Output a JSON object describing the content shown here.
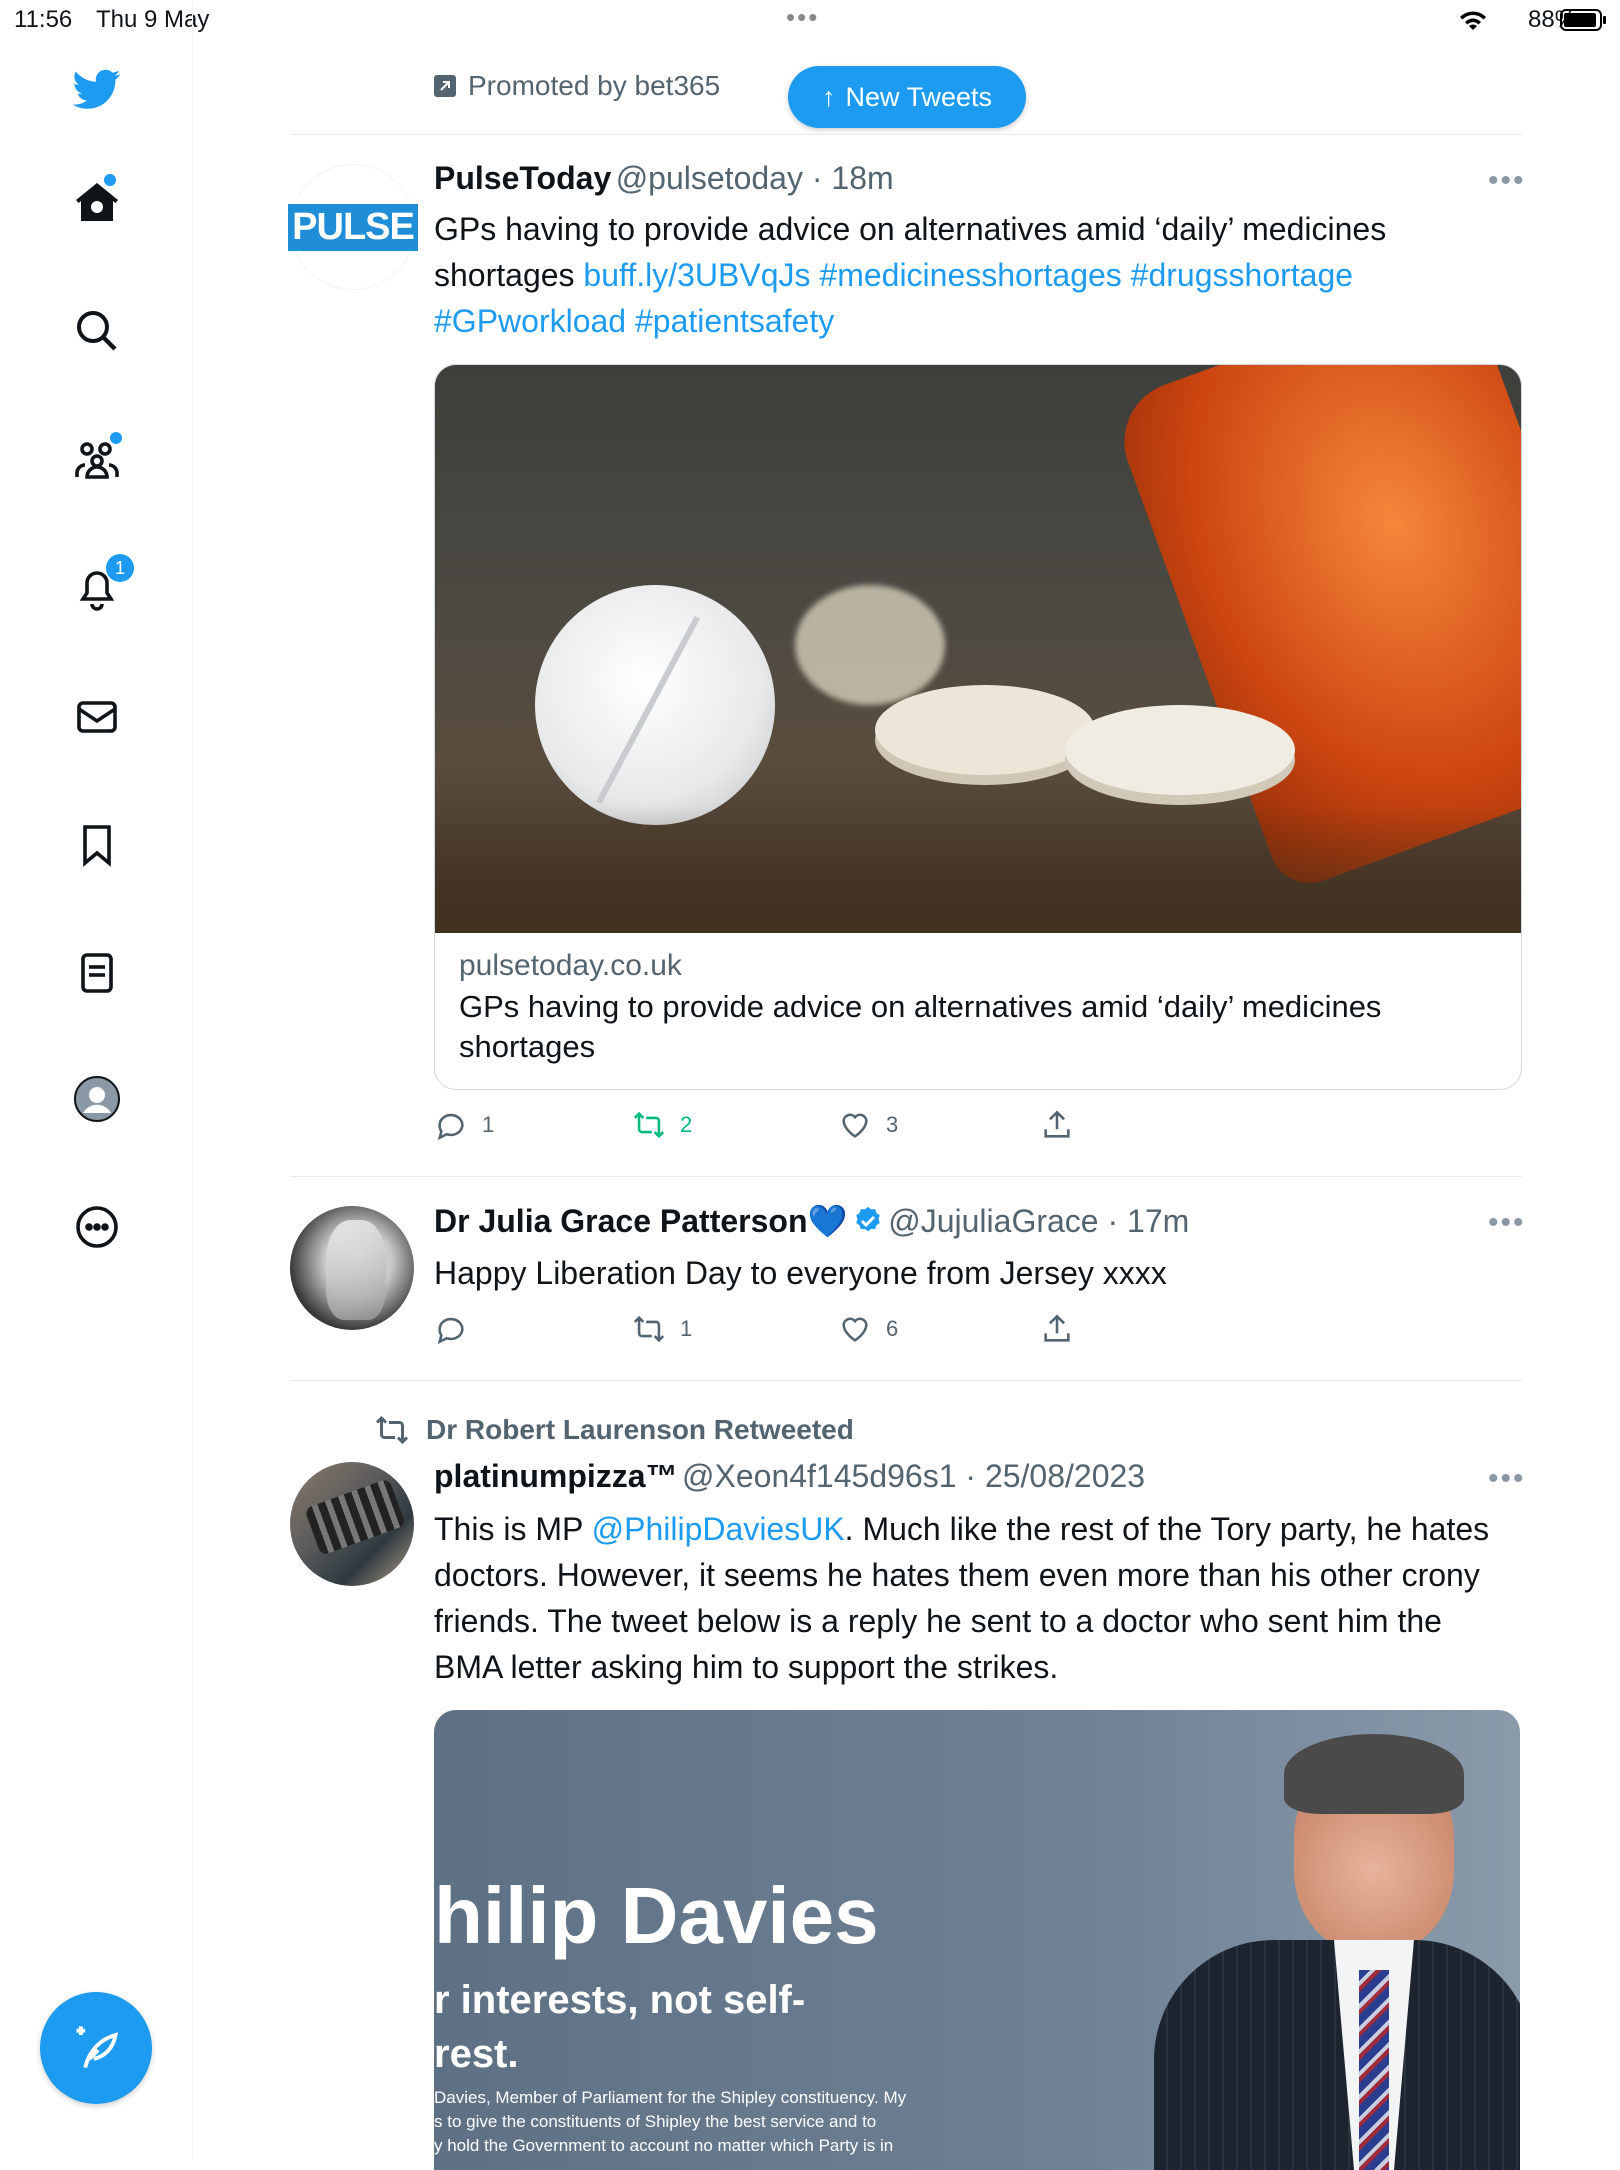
{
  "status_bar": {
    "time": "11:56",
    "date": "Thu 9 May",
    "battery": "88%"
  },
  "sidebar": {
    "items": [
      {
        "icon": "twitter-bird-icon"
      },
      {
        "icon": "home-icon"
      },
      {
        "icon": "search-icon"
      },
      {
        "icon": "communities-icon"
      },
      {
        "icon": "notifications-icon",
        "badge": "1"
      },
      {
        "icon": "messages-icon"
      },
      {
        "icon": "bookmarks-icon"
      },
      {
        "icon": "lists-icon"
      },
      {
        "icon": "profile-icon"
      },
      {
        "icon": "more-icon"
      }
    ],
    "compose_icon": "compose-tweet-icon"
  },
  "feed": {
    "promoted": "Promoted by bet365",
    "new_tweets": "New Tweets",
    "tweets": [
      {
        "name": "PulseToday",
        "handle": "@pulsetoday",
        "time": "18m",
        "avatar_text": "PULSE",
        "text": "GPs having to provide advice on alternatives amid ‘daily’ medicines shortages",
        "link": "buff.ly/3UBVqJs",
        "hashtags_line1": "#medicinesshortages #drugsshortage",
        "hashtags_line2": "#GPworkload #patientsafety",
        "card": {
          "domain": "pulsetoday.co.uk",
          "title": "GPs having to provide advice on alternatives amid ‘daily’ medicines shortages"
        },
        "replies": "1",
        "retweets": "2",
        "likes": "3"
      },
      {
        "name": "Dr Julia Grace Patterson💙",
        "handle": "@JujuliaGrace",
        "time": "17m",
        "text": "Happy Liberation Day to everyone from Jersey xxxx",
        "replies": "",
        "retweets": "1",
        "likes": "6"
      },
      {
        "retweeted_by": "Dr Robert Laurenson Retweeted",
        "name": "platinumpizza™",
        "handle": "@Xeon4f145d96s1",
        "time": "25/08/2023",
        "text_pre": "This is MP ",
        "mention": "@PhilipDaviesUK",
        "text_post": ". Much like the rest of the Tory party, he hates doctors. However, it seems he hates them even more than his other crony friends. The tweet below is a reply he sent to a doctor who sent him the BMA letter asking him to support the strikes.",
        "image": {
          "headline": "hilip Davies",
          "sub1": "r interests, not self-",
          "sub2": "rest.",
          "small1": "Davies, Member of Parliament for the Shipley constituency. My",
          "small2": "s to give the constituents of Shipley the best service and to",
          "small3": "y hold the Government to account no matter which Party is in"
        }
      }
    ]
  }
}
